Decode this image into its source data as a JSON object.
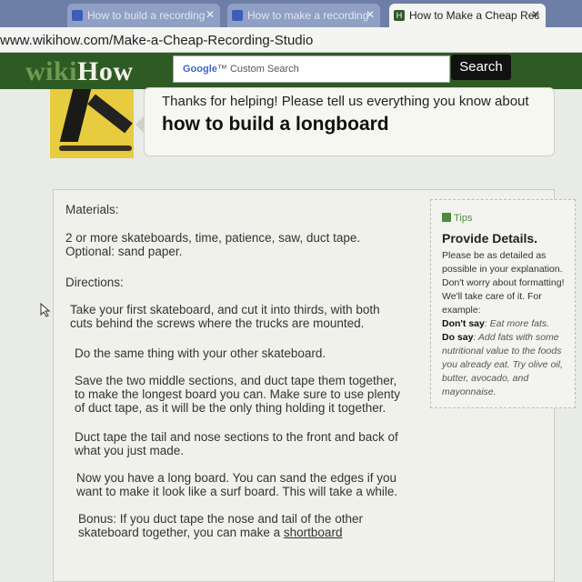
{
  "browser": {
    "tabs": [
      {
        "title": "How to build a recording"
      },
      {
        "title": "How to make a recording"
      },
      {
        "title": "How to Make a Cheap Rec"
      }
    ],
    "url": "www.wikihow.com/Make-a-Cheap-Recording-Studio"
  },
  "header": {
    "logo_wiki": "wiki",
    "logo_how": "How",
    "search_google": "Google",
    "search_placeholder": "Custom Search",
    "search_button": "Search"
  },
  "banner": {
    "line1": "Thanks for helping! Please tell us everything you know about",
    "line2": "how to build a longboard"
  },
  "content": {
    "paragraphs": [
      "Materials:",
      "2 or more skateboards, time, patience, saw, duct tape.\nOptional:  sand paper.",
      "Directions:",
      "Take your first skateboard, and cut it into thirds, with both\ncuts behind the screws where the trucks are mounted.",
      "Do the same thing with your other skateboard.",
      "Save the two middle sections, and duct tape them together,\nto make the longest board you can.  Make sure to use plenty\nof duct tape, as it will be the only thing holding it together.",
      "Duct tape the tail and nose sections to the front and back of\nwhat you just made.",
      "Now you have a long board.  You can sand the edges if you\nwant to make it look like a surf board.  This will take a while.",
      "Bonus:  If you duct tape the nose and tail of the other\nskateboard together, you can make a "
    ],
    "bonus_link": "shortboard"
  },
  "tips": {
    "badge": "Tips",
    "title": "Provide Details.",
    "body": "Please be as detailed as possible in your explanation. Don't worry about formatting! We'll take care of it. For example:",
    "dont_label": "Don't say",
    "dont_text": ": Eat more fats.",
    "do_label": "Do say",
    "do_text": ": Add fats with some nutritional value to the foods you already eat. Try olive oil, butter, avocado, and mayonnaise."
  },
  "colors": {
    "header_green": "#2e5a23",
    "logo_wiki": "#6f9a52",
    "tips_green": "#4f8b3a"
  }
}
